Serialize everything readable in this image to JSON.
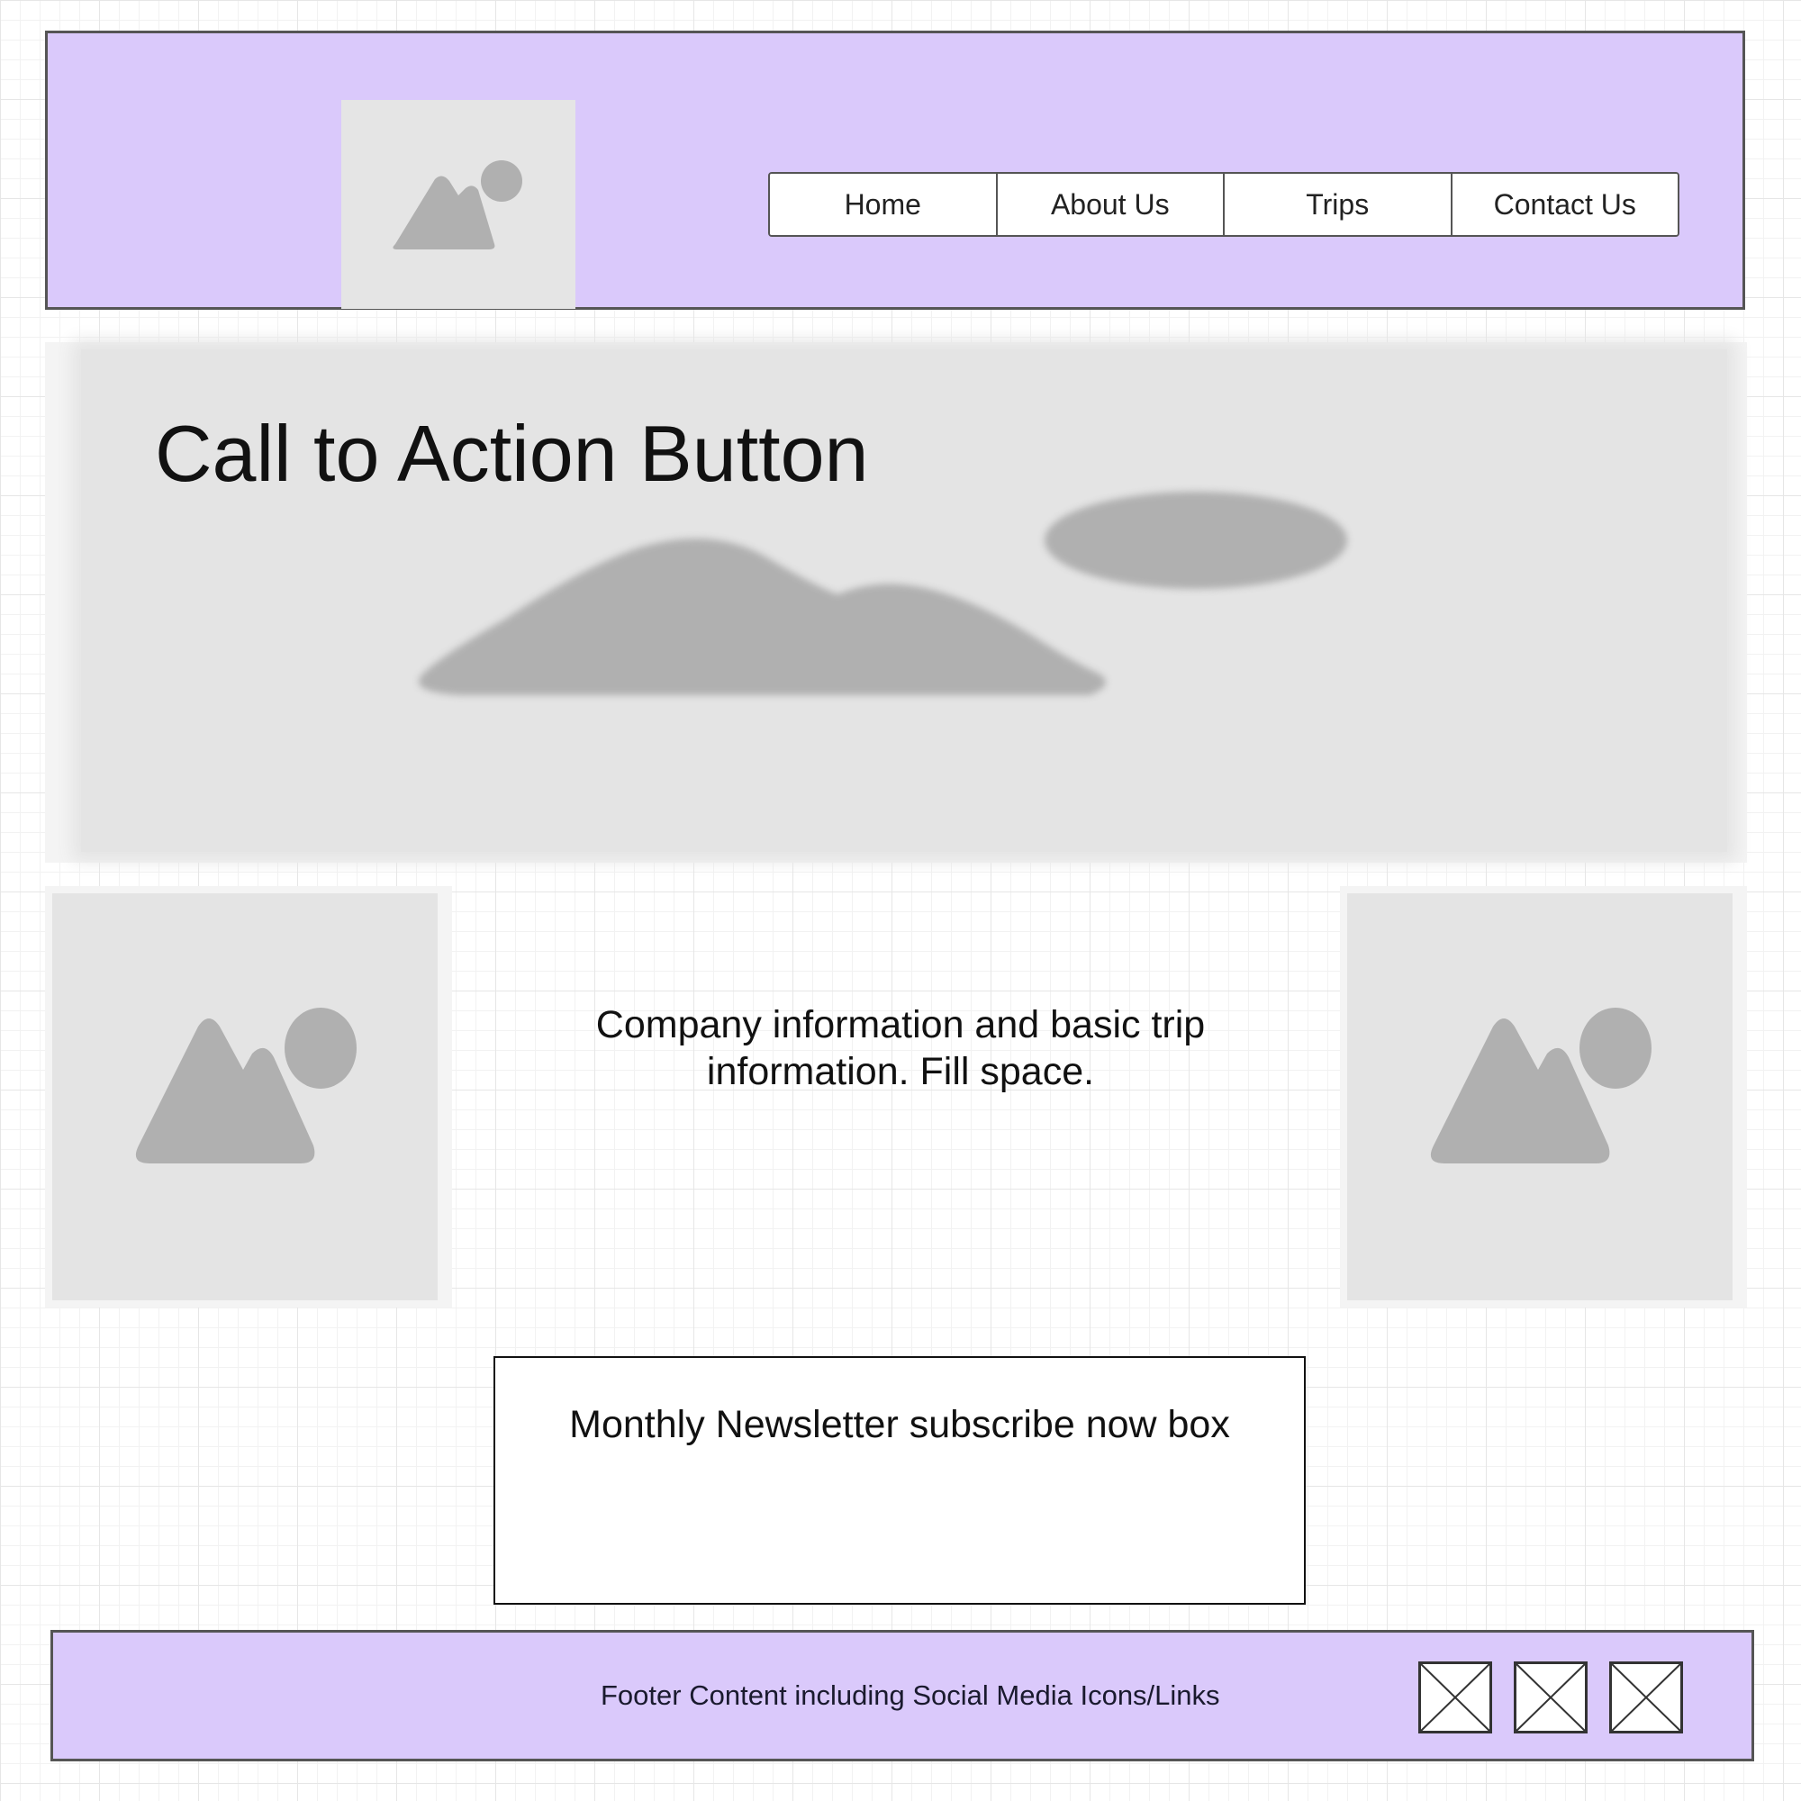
{
  "header": {
    "logo_icon": "image-placeholder-icon",
    "nav": [
      {
        "label": "Home"
      },
      {
        "label": "About Us"
      },
      {
        "label": "Trips"
      },
      {
        "label": "Contact Us"
      }
    ],
    "background_color": "#dac9fb"
  },
  "hero": {
    "title": "Call to Action Button",
    "image_icon": "image-placeholder-icon"
  },
  "content": {
    "company_info": "Company information and basic trip information. Fill space.",
    "left_image_icon": "image-placeholder-icon",
    "right_image_icon": "image-placeholder-icon"
  },
  "newsletter": {
    "text": "Monthly Newsletter subscribe now box"
  },
  "footer": {
    "text": "Footer Content including Social Media Icons/Links",
    "social_icons": [
      "social-icon-placeholder",
      "social-icon-placeholder",
      "social-icon-placeholder"
    ],
    "background_color": "#dac9fb"
  }
}
